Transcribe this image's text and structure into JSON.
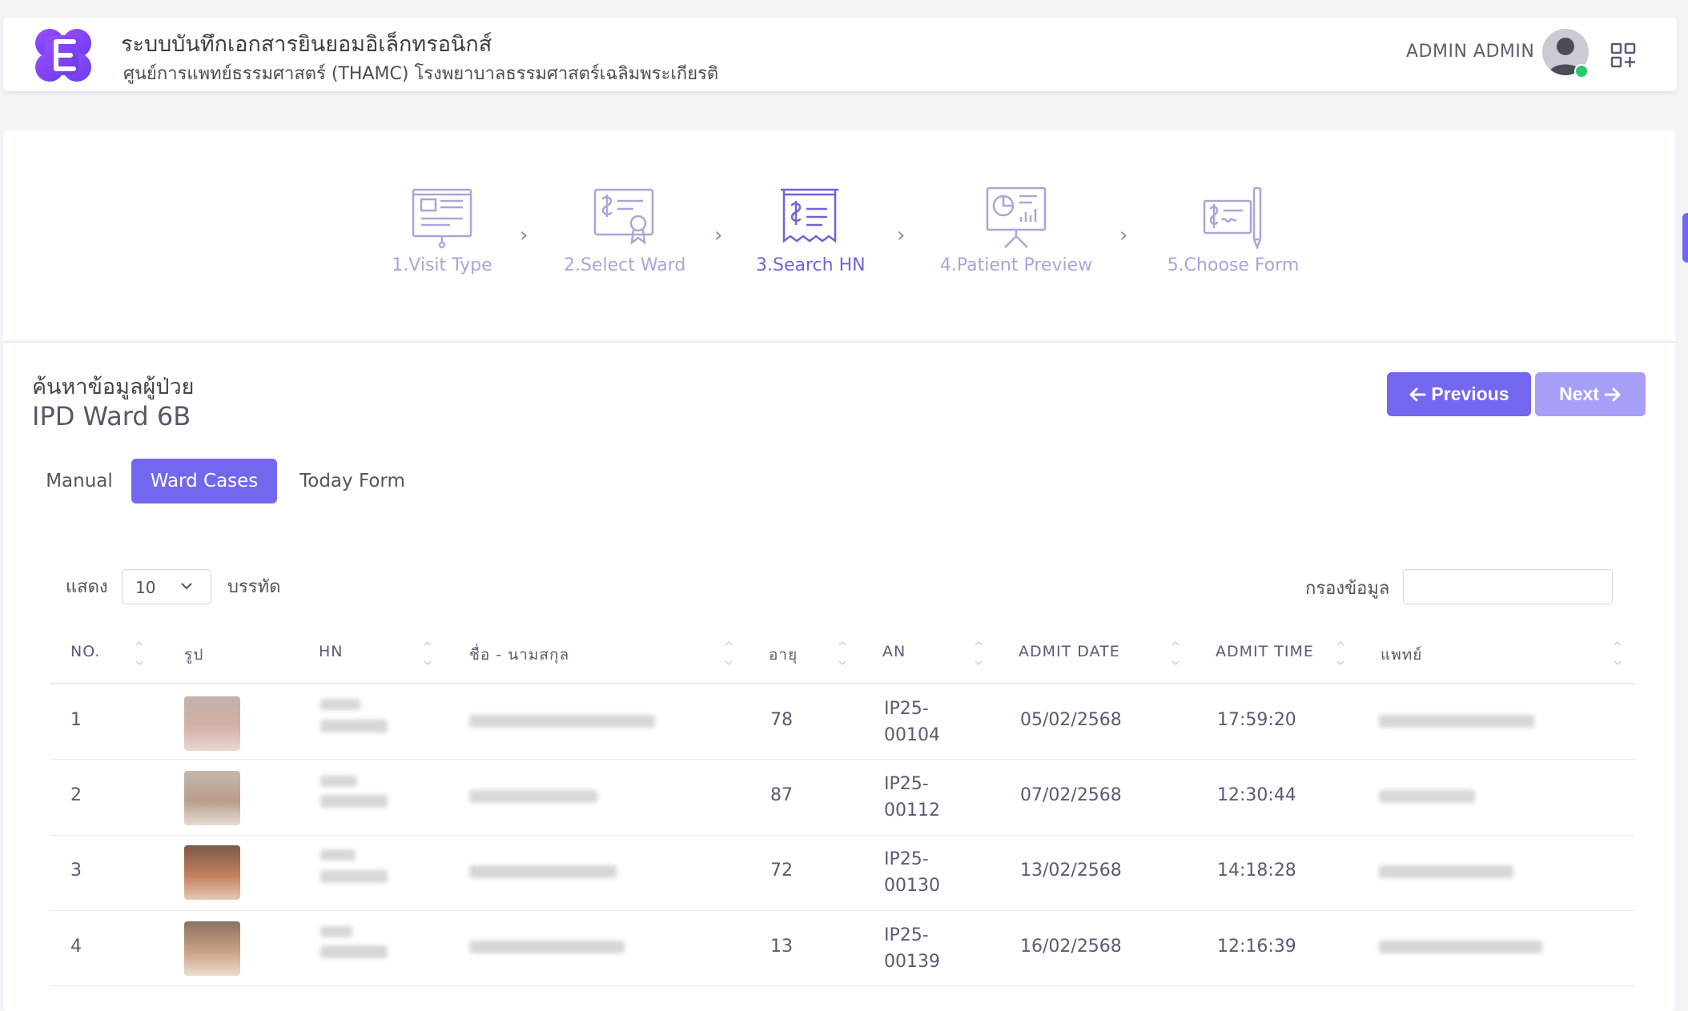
{
  "header": {
    "title": "ระบบบันทึกเอกสารยินยอมอิเล็กทรอนิกส์",
    "subtitle": "ศูนย์การแพทย์ธรรมศาสตร์ (THAMC) โรงพยาบาลธรรมศาสตร์เฉลิมพระเกียรติ",
    "user_name": "ADMIN ADMIN"
  },
  "steps": [
    {
      "label": "1.Visit Type",
      "icon": "visit-type-icon"
    },
    {
      "label": "2.Select Ward",
      "icon": "select-ward-icon"
    },
    {
      "label": "3.Search HN",
      "icon": "search-hn-icon",
      "active": true
    },
    {
      "label": "4.Patient Preview",
      "icon": "patient-preview-icon"
    },
    {
      "label": "5.Choose Form",
      "icon": "choose-form-icon"
    }
  ],
  "section": {
    "title": "ค้นหาข้อมูลผู้ป่วย",
    "ward": "IPD Ward 6B"
  },
  "nav": {
    "previous": "Previous",
    "next": "Next"
  },
  "tabs": [
    "Manual",
    "Ward Cases",
    "Today Form"
  ],
  "table_controls": {
    "show_label": "แสดง",
    "page_size": "10",
    "rows_label": "บรรทัด",
    "filter_label": "กรองข้อมูล"
  },
  "columns": [
    "NO.",
    "รูป",
    "HN",
    "ชื่อ - นามสกุล",
    "อายุ",
    "AN",
    "ADMIT DATE",
    "ADMIT TIME",
    "แพทย์"
  ],
  "rows": [
    {
      "no": "1",
      "age": "78",
      "an_1": "IP25-",
      "an_2": "00104",
      "admit_date": "05/02/2568",
      "admit_time": "17:59:20"
    },
    {
      "no": "2",
      "age": "87",
      "an_1": "IP25-",
      "an_2": "00112",
      "admit_date": "07/02/2568",
      "admit_time": "12:30:44"
    },
    {
      "no": "3",
      "age": "72",
      "an_1": "IP25-",
      "an_2": "00130",
      "admit_date": "13/02/2568",
      "admit_time": "14:18:28"
    },
    {
      "no": "4",
      "age": "13",
      "an_1": "IP25-",
      "an_2": "00139",
      "admit_date": "16/02/2568",
      "admit_time": "12:16:39"
    }
  ],
  "colors": {
    "primary": "#7367f0",
    "primary_disabled": "#a79ff7",
    "step_inactive": "#a9a6d8",
    "online": "#28c76f"
  }
}
